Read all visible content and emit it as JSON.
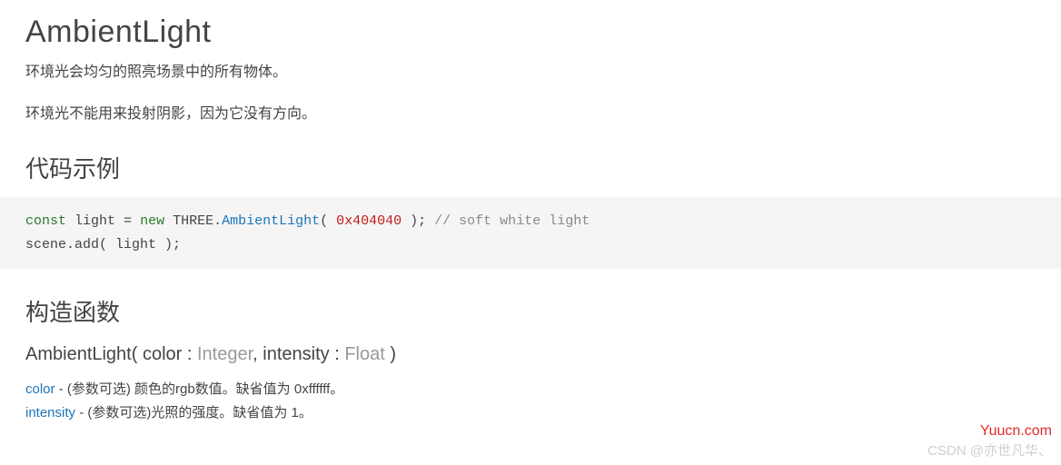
{
  "title": "AmbientLight",
  "description1": "环境光会均匀的照亮场景中的所有物体。",
  "description2": "环境光不能用来投射阴影，因为它没有方向。",
  "codeExampleHeading": "代码示例",
  "code": {
    "const": "const",
    "light": "light",
    "eq": " = ",
    "new": "new",
    "three": " THREE.",
    "ambient": "AmbientLight",
    "lparen": "( ",
    "hex": "0x404040",
    "rparen": " );",
    "comment": " // soft white light",
    "line2_scene": "scene",
    "line2_add": ".add( light );"
  },
  "constructorHeading": "构造函数",
  "signature": {
    "name": "AmbientLight",
    "open": "( ",
    "p1": "color : ",
    "t1": "Integer",
    "sep": ", ",
    "p2": "intensity : ",
    "t2": "Float",
    "close": " )"
  },
  "params": {
    "color_name": "color",
    "color_desc": " - (参数可选) 颜色的rgb数值。缺省值为 0xffffff。",
    "intensity_name": "intensity",
    "intensity_desc": " - (参数可选)光照的强度。缺省值为 1。"
  },
  "watermark_site": "Yuucn.com",
  "watermark_csdn": "CSDN @亦世凡华、"
}
